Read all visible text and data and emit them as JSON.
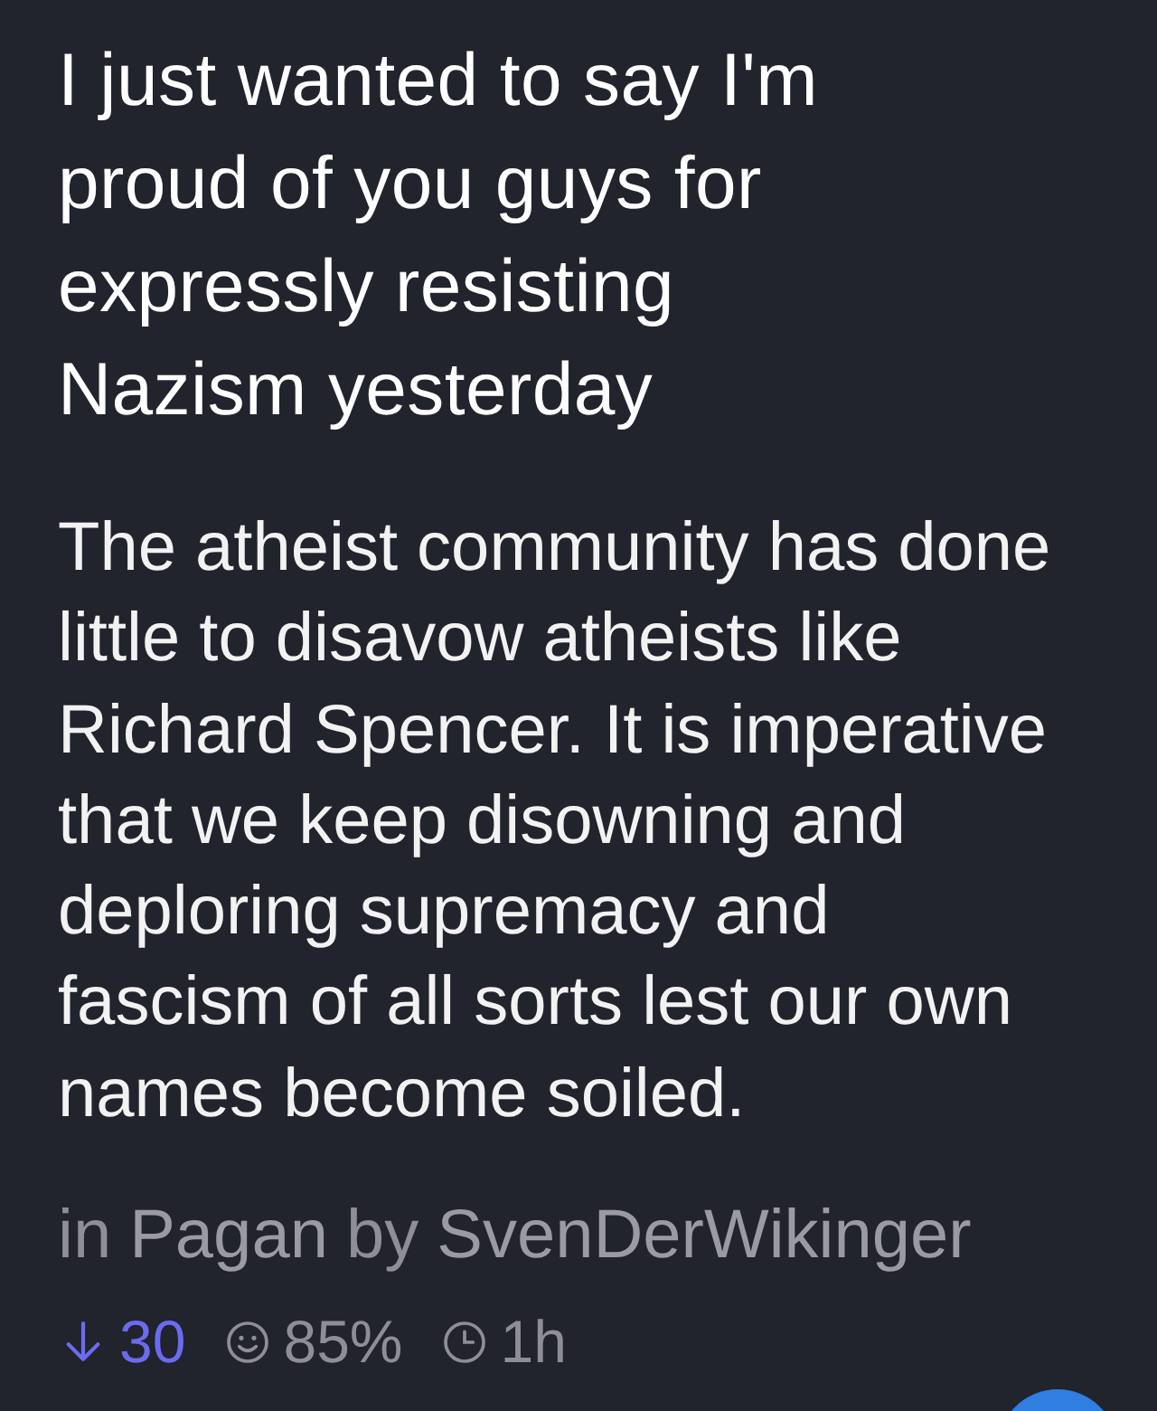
{
  "post": {
    "title_lines": [
      "I just wanted to say I'm",
      "proud of you guys for",
      "expressly resisting",
      "Nazism yesterday"
    ],
    "body_lines": [
      "The atheist community has done",
      "little to disavow atheists like",
      "Richard Spencer. It is imperative",
      "that we keep disowning and",
      "deploring supremacy and",
      "fascism of all sorts lest our own",
      "names become soiled."
    ],
    "meta": {
      "in_label": "in",
      "subreddit": "Pagan",
      "by_label": "by",
      "author": "SvenDerWikinger"
    },
    "stats": {
      "downvoted": true,
      "score": "30",
      "ratio": "85%",
      "age": "1h"
    }
  }
}
